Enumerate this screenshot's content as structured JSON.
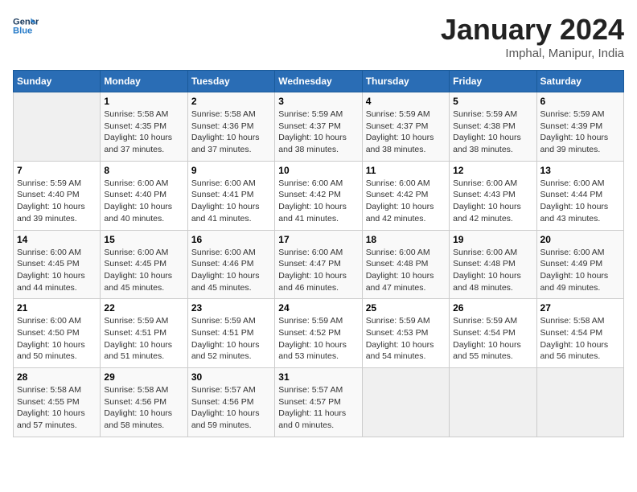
{
  "header": {
    "logo_general": "General",
    "logo_blue": "Blue",
    "month_title": "January 2024",
    "subtitle": "Imphal, Manipur, India"
  },
  "days_of_week": [
    "Sunday",
    "Monday",
    "Tuesday",
    "Wednesday",
    "Thursday",
    "Friday",
    "Saturday"
  ],
  "weeks": [
    [
      {
        "day": "",
        "sunrise": "",
        "sunset": "",
        "daylight": ""
      },
      {
        "day": "1",
        "sunrise": "Sunrise: 5:58 AM",
        "sunset": "Sunset: 4:35 PM",
        "daylight": "Daylight: 10 hours and 37 minutes."
      },
      {
        "day": "2",
        "sunrise": "Sunrise: 5:58 AM",
        "sunset": "Sunset: 4:36 PM",
        "daylight": "Daylight: 10 hours and 37 minutes."
      },
      {
        "day": "3",
        "sunrise": "Sunrise: 5:59 AM",
        "sunset": "Sunset: 4:37 PM",
        "daylight": "Daylight: 10 hours and 38 minutes."
      },
      {
        "day": "4",
        "sunrise": "Sunrise: 5:59 AM",
        "sunset": "Sunset: 4:37 PM",
        "daylight": "Daylight: 10 hours and 38 minutes."
      },
      {
        "day": "5",
        "sunrise": "Sunrise: 5:59 AM",
        "sunset": "Sunset: 4:38 PM",
        "daylight": "Daylight: 10 hours and 38 minutes."
      },
      {
        "day": "6",
        "sunrise": "Sunrise: 5:59 AM",
        "sunset": "Sunset: 4:39 PM",
        "daylight": "Daylight: 10 hours and 39 minutes."
      }
    ],
    [
      {
        "day": "7",
        "sunrise": "Sunrise: 5:59 AM",
        "sunset": "Sunset: 4:40 PM",
        "daylight": "Daylight: 10 hours and 39 minutes."
      },
      {
        "day": "8",
        "sunrise": "Sunrise: 6:00 AM",
        "sunset": "Sunset: 4:40 PM",
        "daylight": "Daylight: 10 hours and 40 minutes."
      },
      {
        "day": "9",
        "sunrise": "Sunrise: 6:00 AM",
        "sunset": "Sunset: 4:41 PM",
        "daylight": "Daylight: 10 hours and 41 minutes."
      },
      {
        "day": "10",
        "sunrise": "Sunrise: 6:00 AM",
        "sunset": "Sunset: 4:42 PM",
        "daylight": "Daylight: 10 hours and 41 minutes."
      },
      {
        "day": "11",
        "sunrise": "Sunrise: 6:00 AM",
        "sunset": "Sunset: 4:42 PM",
        "daylight": "Daylight: 10 hours and 42 minutes."
      },
      {
        "day": "12",
        "sunrise": "Sunrise: 6:00 AM",
        "sunset": "Sunset: 4:43 PM",
        "daylight": "Daylight: 10 hours and 42 minutes."
      },
      {
        "day": "13",
        "sunrise": "Sunrise: 6:00 AM",
        "sunset": "Sunset: 4:44 PM",
        "daylight": "Daylight: 10 hours and 43 minutes."
      }
    ],
    [
      {
        "day": "14",
        "sunrise": "Sunrise: 6:00 AM",
        "sunset": "Sunset: 4:45 PM",
        "daylight": "Daylight: 10 hours and 44 minutes."
      },
      {
        "day": "15",
        "sunrise": "Sunrise: 6:00 AM",
        "sunset": "Sunset: 4:45 PM",
        "daylight": "Daylight: 10 hours and 45 minutes."
      },
      {
        "day": "16",
        "sunrise": "Sunrise: 6:00 AM",
        "sunset": "Sunset: 4:46 PM",
        "daylight": "Daylight: 10 hours and 45 minutes."
      },
      {
        "day": "17",
        "sunrise": "Sunrise: 6:00 AM",
        "sunset": "Sunset: 4:47 PM",
        "daylight": "Daylight: 10 hours and 46 minutes."
      },
      {
        "day": "18",
        "sunrise": "Sunrise: 6:00 AM",
        "sunset": "Sunset: 4:48 PM",
        "daylight": "Daylight: 10 hours and 47 minutes."
      },
      {
        "day": "19",
        "sunrise": "Sunrise: 6:00 AM",
        "sunset": "Sunset: 4:48 PM",
        "daylight": "Daylight: 10 hours and 48 minutes."
      },
      {
        "day": "20",
        "sunrise": "Sunrise: 6:00 AM",
        "sunset": "Sunset: 4:49 PM",
        "daylight": "Daylight: 10 hours and 49 minutes."
      }
    ],
    [
      {
        "day": "21",
        "sunrise": "Sunrise: 6:00 AM",
        "sunset": "Sunset: 4:50 PM",
        "daylight": "Daylight: 10 hours and 50 minutes."
      },
      {
        "day": "22",
        "sunrise": "Sunrise: 5:59 AM",
        "sunset": "Sunset: 4:51 PM",
        "daylight": "Daylight: 10 hours and 51 minutes."
      },
      {
        "day": "23",
        "sunrise": "Sunrise: 5:59 AM",
        "sunset": "Sunset: 4:51 PM",
        "daylight": "Daylight: 10 hours and 52 minutes."
      },
      {
        "day": "24",
        "sunrise": "Sunrise: 5:59 AM",
        "sunset": "Sunset: 4:52 PM",
        "daylight": "Daylight: 10 hours and 53 minutes."
      },
      {
        "day": "25",
        "sunrise": "Sunrise: 5:59 AM",
        "sunset": "Sunset: 4:53 PM",
        "daylight": "Daylight: 10 hours and 54 minutes."
      },
      {
        "day": "26",
        "sunrise": "Sunrise: 5:59 AM",
        "sunset": "Sunset: 4:54 PM",
        "daylight": "Daylight: 10 hours and 55 minutes."
      },
      {
        "day": "27",
        "sunrise": "Sunrise: 5:58 AM",
        "sunset": "Sunset: 4:54 PM",
        "daylight": "Daylight: 10 hours and 56 minutes."
      }
    ],
    [
      {
        "day": "28",
        "sunrise": "Sunrise: 5:58 AM",
        "sunset": "Sunset: 4:55 PM",
        "daylight": "Daylight: 10 hours and 57 minutes."
      },
      {
        "day": "29",
        "sunrise": "Sunrise: 5:58 AM",
        "sunset": "Sunset: 4:56 PM",
        "daylight": "Daylight: 10 hours and 58 minutes."
      },
      {
        "day": "30",
        "sunrise": "Sunrise: 5:57 AM",
        "sunset": "Sunset: 4:56 PM",
        "daylight": "Daylight: 10 hours and 59 minutes."
      },
      {
        "day": "31",
        "sunrise": "Sunrise: 5:57 AM",
        "sunset": "Sunset: 4:57 PM",
        "daylight": "Daylight: 11 hours and 0 minutes."
      },
      {
        "day": "",
        "sunrise": "",
        "sunset": "",
        "daylight": ""
      },
      {
        "day": "",
        "sunrise": "",
        "sunset": "",
        "daylight": ""
      },
      {
        "day": "",
        "sunrise": "",
        "sunset": "",
        "daylight": ""
      }
    ]
  ]
}
